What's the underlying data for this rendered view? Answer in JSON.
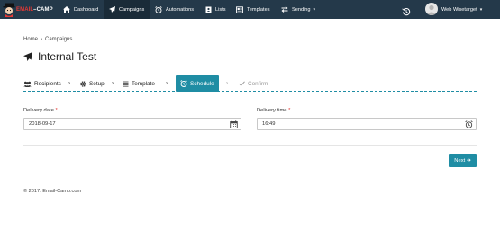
{
  "app": {
    "logo_prefix": "EMAIL",
    "logo_suffix": "CAMP",
    "accent_color": "#1f8da4",
    "nav_color": "#24394a"
  },
  "nav": {
    "items": [
      {
        "label": "Dashboard",
        "icon": "home-icon"
      },
      {
        "label": "Campaigns",
        "icon": "paper-plane-icon",
        "active": true
      },
      {
        "label": "Automations",
        "icon": "alarm-clock-icon"
      },
      {
        "label": "Lists",
        "icon": "address-book-icon"
      },
      {
        "label": "Templates",
        "icon": "newspaper-icon"
      },
      {
        "label": "Sending",
        "icon": "exchange-arrows-icon",
        "has_caret": true
      }
    ],
    "history_icon": "history-icon",
    "user_name": "Web Wisetarget"
  },
  "breadcrumb": {
    "home": "Home",
    "separator": "›",
    "current": "Campaigns"
  },
  "page": {
    "title": "Internal Test",
    "title_icon": "paper-plane-icon"
  },
  "wizard": {
    "steps": [
      {
        "label": "Recipients",
        "icon": "users-icon",
        "state": "done"
      },
      {
        "label": "Setup",
        "icon": "gear-icon",
        "state": "done"
      },
      {
        "label": "Template",
        "icon": "list-icon",
        "state": "done"
      },
      {
        "label": "Schedule",
        "icon": "alarm-clock-icon",
        "state": "active"
      },
      {
        "label": "Confirm",
        "icon": "check-icon",
        "state": "disabled"
      }
    ],
    "arrow": "›"
  },
  "form": {
    "delivery_date": {
      "label": "Delivery date",
      "required_mark": "*",
      "value": "2018-09-17"
    },
    "delivery_time": {
      "label": "Delivery time",
      "required_mark": "*",
      "value": "16:49"
    }
  },
  "actions": {
    "next_label": "Next",
    "next_arrow": "➔"
  },
  "footer": {
    "copyright": "© 2017. Email-Camp.com"
  }
}
